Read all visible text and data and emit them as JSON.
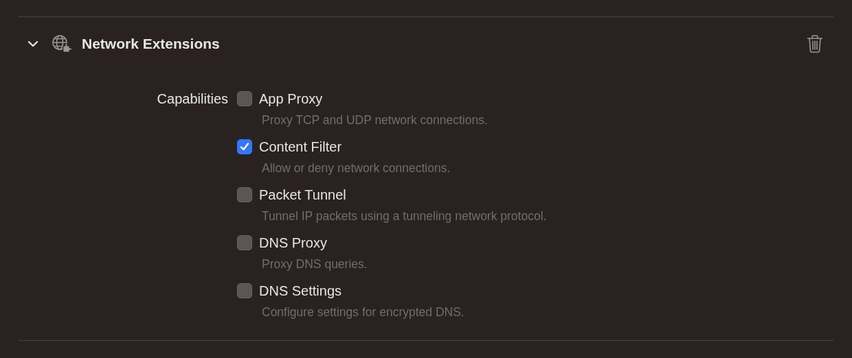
{
  "section": {
    "title": "Network Extensions",
    "expanded": true
  },
  "capabilities": {
    "label": "Capabilities",
    "items": [
      {
        "name": "App Proxy",
        "description": "Proxy TCP and UDP network connections.",
        "checked": false
      },
      {
        "name": "Content Filter",
        "description": "Allow or deny network connections.",
        "checked": true
      },
      {
        "name": "Packet Tunnel",
        "description": "Tunnel IP packets using a tunneling network protocol.",
        "checked": false
      },
      {
        "name": "DNS Proxy",
        "description": "Proxy DNS queries.",
        "checked": false
      },
      {
        "name": "DNS Settings",
        "description": "Configure settings for encrypted DNS.",
        "checked": false
      }
    ]
  }
}
